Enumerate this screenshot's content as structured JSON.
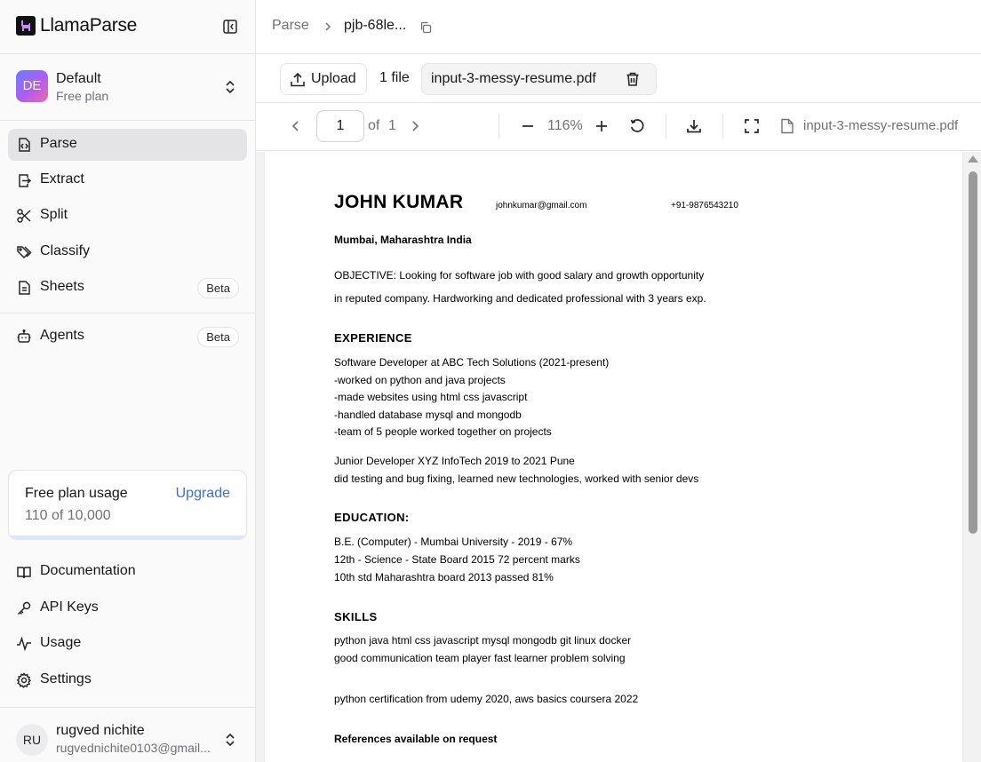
{
  "app": {
    "name": "LlamaParse"
  },
  "org": {
    "initials": "DE",
    "name": "Default",
    "plan": "Free plan"
  },
  "nav": {
    "items": [
      {
        "label": "Parse"
      },
      {
        "label": "Extract"
      },
      {
        "label": "Split"
      },
      {
        "label": "Classify"
      },
      {
        "label": "Sheets",
        "badge": "Beta"
      },
      {
        "label": "Agents",
        "badge": "Beta"
      }
    ]
  },
  "usage": {
    "title": "Free plan usage",
    "count": "110 of 10,000",
    "upgrade": "Upgrade",
    "fraction_used": 0.011
  },
  "footer_nav": {
    "items": [
      {
        "label": "Documentation"
      },
      {
        "label": "API Keys"
      },
      {
        "label": "Usage"
      },
      {
        "label": "Settings"
      }
    ]
  },
  "user": {
    "initials": "RU",
    "name": "rugved nichite",
    "email": "rugvednichite0103@gmail..."
  },
  "breadcrumb": {
    "root": "Parse",
    "job": "pjb-68le..."
  },
  "filebar": {
    "upload_label": "Upload",
    "file_count": "1 file",
    "file_name": "input-3-messy-resume.pdf"
  },
  "viewer": {
    "page": "1",
    "of": "of",
    "total": "1",
    "zoom": "116%",
    "file_name": "input-3-messy-resume.pdf"
  },
  "resume": {
    "name": "JOHN KUMAR",
    "email": "johnkumar@gmail.com",
    "phone": "+91-9876543210",
    "location": "Mumbai, Maharashtra India",
    "objective_1": "OBJECTIVE: Looking for software job with good salary and growth opportunity",
    "objective_2": "in reputed company. Hardworking and dedicated professional with 3 years exp.",
    "experience_heading": "EXPERIENCE",
    "exp": [
      "Software Developer at ABC Tech Solutions (2021-present)",
      "-worked on python and java projects",
      "-made websites using html css javascript",
      "-handled database mysql and mongodb",
      "-team of 5 people worked together on projects",
      "Junior Developer XYZ InfoTech 2019 to 2021 Pune",
      "did testing and bug fixing, learned new technologies, worked with senior devs"
    ],
    "education_heading": "EDUCATION:",
    "edu": [
      "B.E. (Computer) - Mumbai University - 2019 - 67%",
      "12th - Science - State Board 2015 72 percent marks",
      "10th std Maharashtra board 2013 passed 81%"
    ],
    "skills_heading": "SKILLS",
    "skills": [
      "python java html css javascript mysql mongodb git linux docker",
      "good communication team player fast learner problem solving"
    ],
    "certifications": "python certification from udemy 2020, aws basics coursera 2022",
    "references": "References available on request"
  }
}
